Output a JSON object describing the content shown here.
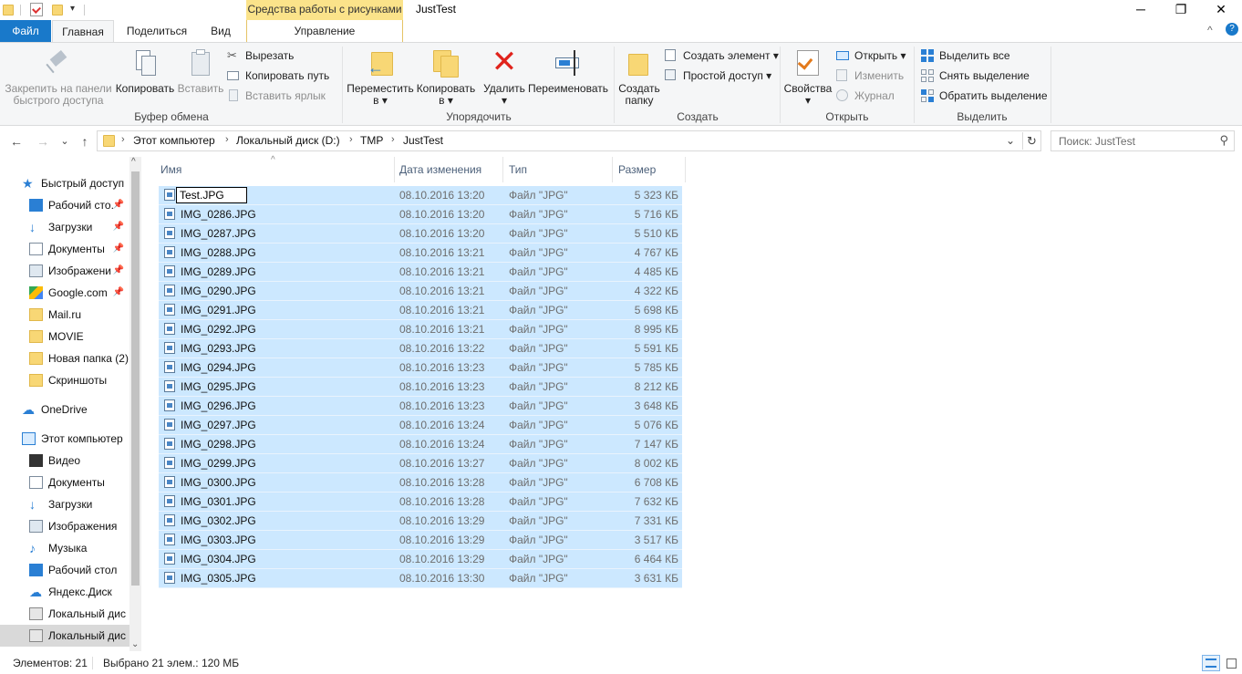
{
  "titlebar": {
    "context_tab_group": "Средства работы с рисунками",
    "window_title": "JustTest",
    "minimize": "─",
    "maximize": "❐",
    "close": "✕"
  },
  "tabs": {
    "file": "Файл",
    "home": "Главная",
    "share": "Поделиться",
    "view": "Вид",
    "manage": "Управление",
    "help": "?",
    "collapse": "^"
  },
  "ribbon": {
    "clipboard": {
      "label": "Буфер обмена",
      "pin_line1": "Закрепить на панели",
      "pin_line2": "быстрого доступа",
      "copy": "Копировать",
      "paste": "Вставить",
      "cut": "Вырезать",
      "copy_path": "Копировать путь",
      "paste_shortcut": "Вставить ярлык"
    },
    "organize": {
      "label": "Упорядочить",
      "move_line1": "Переместить",
      "move_line2": "в ▾",
      "copyto_line1": "Копировать",
      "copyto_line2": "в ▾",
      "delete_line1": "Удалить",
      "delete_line2": "▾",
      "rename": "Переименовать"
    },
    "new": {
      "label": "Создать",
      "newfolder_line1": "Создать",
      "newfolder_line2": "папку",
      "new_item": "Создать элемент ▾",
      "easy_access": "Простой доступ ▾"
    },
    "open": {
      "label": "Открыть",
      "properties_line1": "Свойства",
      "properties_line2": "▾",
      "open": "Открыть ▾",
      "edit": "Изменить",
      "history": "Журнал"
    },
    "select": {
      "label": "Выделить",
      "select_all": "Выделить все",
      "select_none": "Снять выделение",
      "invert": "Обратить выделение"
    }
  },
  "address": {
    "back": "←",
    "forward": "→",
    "recent": "⌄",
    "up": "↑",
    "sep": "›",
    "crumbs": [
      "Этот компьютер",
      "Локальный диск (D:)",
      "TMP",
      "JustTest"
    ],
    "dropdown": "⌄",
    "refresh": "↻",
    "search_placeholder": "Поиск: JustTest",
    "search_glyph": "⚲"
  },
  "navpane": {
    "items": [
      {
        "label": "Быстрый доступ",
        "pinned": false
      },
      {
        "label": "Рабочий сто.",
        "pinned": true
      },
      {
        "label": "Загрузки",
        "pinned": true
      },
      {
        "label": "Документы",
        "pinned": true
      },
      {
        "label": "Изображени",
        "pinned": true
      },
      {
        "label": "Google.com",
        "pinned": true
      },
      {
        "label": "Mail.ru",
        "pinned": false
      },
      {
        "label": "MOVIE",
        "pinned": false
      },
      {
        "label": "Новая папка (2)",
        "pinned": false
      },
      {
        "label": "Скриншоты",
        "pinned": false
      },
      {
        "label": "OneDrive",
        "pinned": false
      },
      {
        "label": "Этот компьютер",
        "pinned": false
      },
      {
        "label": "Видео",
        "pinned": false
      },
      {
        "label": "Документы",
        "pinned": false
      },
      {
        "label": "Загрузки",
        "pinned": false
      },
      {
        "label": "Изображения",
        "pinned": false
      },
      {
        "label": "Музыка",
        "pinned": false
      },
      {
        "label": "Рабочий стол",
        "pinned": false
      },
      {
        "label": "Яндекс.Диск",
        "pinned": false
      },
      {
        "label": "Локальный дис",
        "pinned": false
      },
      {
        "label": "Локальный дис",
        "pinned": false
      }
    ],
    "pin_glyph": "📌",
    "scroll_up": "^",
    "scroll_down": "⌄"
  },
  "filelist": {
    "columns": {
      "name": "Имя",
      "date": "Дата изменения",
      "type": "Тип",
      "size": "Размер"
    },
    "sort_glyph": "^",
    "rename_value": "Test.JPG",
    "rows": [
      {
        "name": "Test.JPG",
        "date": "08.10.2016 13:20",
        "type": "Файл \"JPG\"",
        "size": "5 323 КБ"
      },
      {
        "name": "IMG_0286.JPG",
        "date": "08.10.2016 13:20",
        "type": "Файл \"JPG\"",
        "size": "5 716 КБ"
      },
      {
        "name": "IMG_0287.JPG",
        "date": "08.10.2016 13:20",
        "type": "Файл \"JPG\"",
        "size": "5 510 КБ"
      },
      {
        "name": "IMG_0288.JPG",
        "date": "08.10.2016 13:21",
        "type": "Файл \"JPG\"",
        "size": "4 767 КБ"
      },
      {
        "name": "IMG_0289.JPG",
        "date": "08.10.2016 13:21",
        "type": "Файл \"JPG\"",
        "size": "4 485 КБ"
      },
      {
        "name": "IMG_0290.JPG",
        "date": "08.10.2016 13:21",
        "type": "Файл \"JPG\"",
        "size": "4 322 КБ"
      },
      {
        "name": "IMG_0291.JPG",
        "date": "08.10.2016 13:21",
        "type": "Файл \"JPG\"",
        "size": "5 698 КБ"
      },
      {
        "name": "IMG_0292.JPG",
        "date": "08.10.2016 13:21",
        "type": "Файл \"JPG\"",
        "size": "8 995 КБ"
      },
      {
        "name": "IMG_0293.JPG",
        "date": "08.10.2016 13:22",
        "type": "Файл \"JPG\"",
        "size": "5 591 КБ"
      },
      {
        "name": "IMG_0294.JPG",
        "date": "08.10.2016 13:23",
        "type": "Файл \"JPG\"",
        "size": "5 785 КБ"
      },
      {
        "name": "IMG_0295.JPG",
        "date": "08.10.2016 13:23",
        "type": "Файл \"JPG\"",
        "size": "8 212 КБ"
      },
      {
        "name": "IMG_0296.JPG",
        "date": "08.10.2016 13:23",
        "type": "Файл \"JPG\"",
        "size": "3 648 КБ"
      },
      {
        "name": "IMG_0297.JPG",
        "date": "08.10.2016 13:24",
        "type": "Файл \"JPG\"",
        "size": "5 076 КБ"
      },
      {
        "name": "IMG_0298.JPG",
        "date": "08.10.2016 13:24",
        "type": "Файл \"JPG\"",
        "size": "7 147 КБ"
      },
      {
        "name": "IMG_0299.JPG",
        "date": "08.10.2016 13:27",
        "type": "Файл \"JPG\"",
        "size": "8 002 КБ"
      },
      {
        "name": "IMG_0300.JPG",
        "date": "08.10.2016 13:28",
        "type": "Файл \"JPG\"",
        "size": "6 708 КБ"
      },
      {
        "name": "IMG_0301.JPG",
        "date": "08.10.2016 13:28",
        "type": "Файл \"JPG\"",
        "size": "7 632 КБ"
      },
      {
        "name": "IMG_0302.JPG",
        "date": "08.10.2016 13:29",
        "type": "Файл \"JPG\"",
        "size": "7 331 КБ"
      },
      {
        "name": "IMG_0303.JPG",
        "date": "08.10.2016 13:29",
        "type": "Файл \"JPG\"",
        "size": "3 517 КБ"
      },
      {
        "name": "IMG_0304.JPG",
        "date": "08.10.2016 13:29",
        "type": "Файл \"JPG\"",
        "size": "6 464 КБ"
      },
      {
        "name": "IMG_0305.JPG",
        "date": "08.10.2016 13:30",
        "type": "Файл \"JPG\"",
        "size": "3 631 КБ"
      }
    ]
  },
  "statusbar": {
    "count": "Элементов: 21",
    "selected": "Выбрано 21 элем.: 120 МБ"
  },
  "colors": {
    "accent": "#1979ca",
    "selection": "#cce8ff",
    "context_tab": "#fbe38a"
  }
}
